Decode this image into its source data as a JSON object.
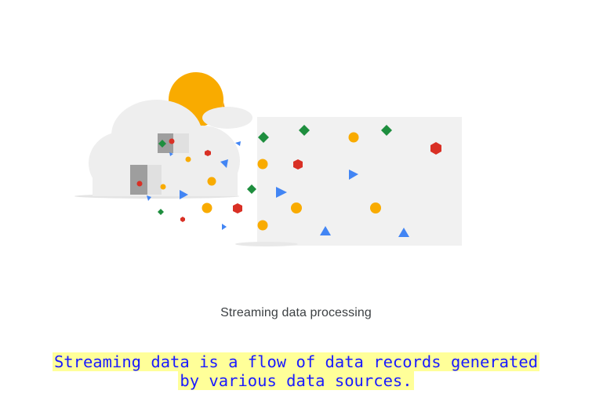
{
  "caption": "Streaming data processing",
  "subtitle": {
    "line1": "Streaming data is a flow of data records generated",
    "line2": "by various data sources."
  },
  "colors": {
    "sun": "#F9AB00",
    "sun_shadow": "#F29900",
    "red": "#D93025",
    "green": "#1E8E3E",
    "blue": "#4285F4",
    "yellow": "#F9AB00",
    "cloud": "#EEEEEE",
    "panel": "#F1F1F1",
    "caption_text": "#3C4043",
    "subtitle_text": "#1A1AFF",
    "subtitle_highlight": "#FFFF99"
  }
}
